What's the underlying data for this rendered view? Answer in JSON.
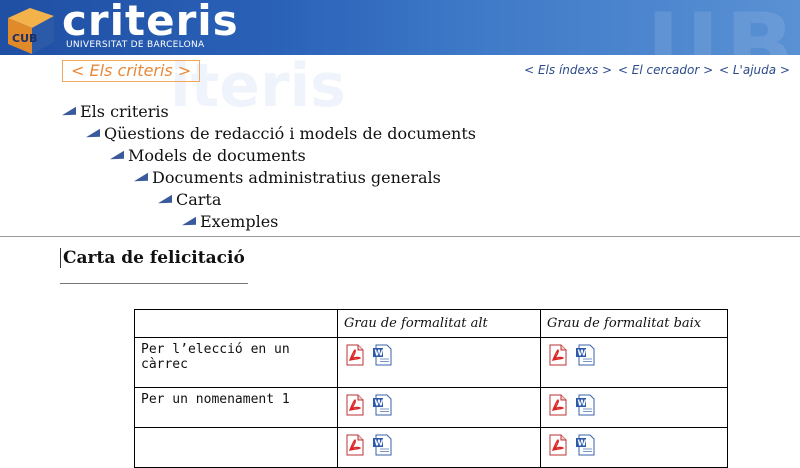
{
  "header": {
    "brand": "criteris",
    "brand_sub": "UNIVERSITAT DE BARCELONA",
    "logo_text": "CUB",
    "colors": {
      "banner": "#2a62b8",
      "accent_orange": "#e8893a",
      "link_blue": "#2c4a8a"
    }
  },
  "nav": {
    "section": "< Els criteris >",
    "links": [
      "< Els índexs >",
      "< El cercador >",
      "< L'ajuda >"
    ]
  },
  "breadcrumb": [
    "Els criteris",
    "Qüestions de redacció i models de documents",
    "Models de documents",
    "Documents administratius generals",
    "Carta",
    "Exemples"
  ],
  "page_title": "Carta de felicitació",
  "table": {
    "headers": [
      "",
      "Grau de formalitat alt",
      "Grau de formalitat baix"
    ],
    "rows": [
      {
        "label": "Per l’elecció en un càrrec",
        "icons": [
          "pdf-icon",
          "word-doc-icon"
        ]
      },
      {
        "label": "Per un nomenament 1",
        "icons": [
          "pdf-icon",
          "word-doc-icon"
        ]
      },
      {
        "label": "",
        "icons": [
          "pdf-icon",
          "word-doc-icon"
        ]
      }
    ]
  }
}
